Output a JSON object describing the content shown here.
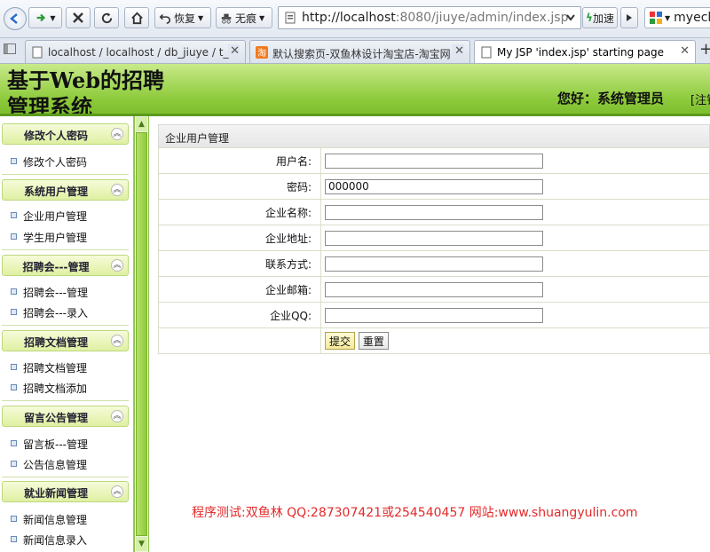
{
  "browser": {
    "nav": {
      "restore_label": "恢复",
      "no_trace_label": "无痕",
      "speed_label": "加速"
    },
    "address_host": "http://localhost",
    "address_rest": ":8080/jiuye/admin/index.jsp",
    "search_value": "myecl",
    "tabs": [
      {
        "label": "localhost / localhost / db_jiuye / t_..."
      },
      {
        "label": "默认搜索页-双鱼林设计淘宝店-淘宝网"
      },
      {
        "label": "My JSP 'index.jsp' starting page"
      }
    ]
  },
  "header": {
    "title": "基于Web的招聘管理系统",
    "greeting": "您好：系统管理员",
    "logout": "[注销"
  },
  "sidebar": {
    "groups": [
      {
        "title": "修改个人密码",
        "items": [
          "修改个人密码"
        ]
      },
      {
        "title": "系统用户管理",
        "items": [
          "企业用户管理",
          "学生用户管理"
        ]
      },
      {
        "title": "招聘会---管理",
        "items": [
          "招聘会---管理",
          "招聘会---录入"
        ]
      },
      {
        "title": "招聘文档管理",
        "items": [
          "招聘文档管理",
          "招聘文档添加"
        ]
      },
      {
        "title": "留言公告管理",
        "items": [
          "留言板---管理",
          "公告信息管理"
        ]
      },
      {
        "title": "就业新闻管理",
        "items": [
          "新闻信息管理",
          "新闻信息录入"
        ]
      }
    ]
  },
  "form": {
    "panel_title": "企业用户管理",
    "fields": [
      {
        "label": "用户名:",
        "value": ""
      },
      {
        "label": "密码:",
        "value": "000000"
      },
      {
        "label": "企业名称:",
        "value": ""
      },
      {
        "label": "企业地址:",
        "value": ""
      },
      {
        "label": "联系方式:",
        "value": ""
      },
      {
        "label": "企业邮箱:",
        "value": ""
      },
      {
        "label": "企业QQ:",
        "value": ""
      }
    ],
    "submit_label": "提交",
    "reset_label": "重置"
  },
  "footer_credit": "程序测试:双鱼林 QQ:287307421或254540457 网站:www.shuangyulin.com"
}
